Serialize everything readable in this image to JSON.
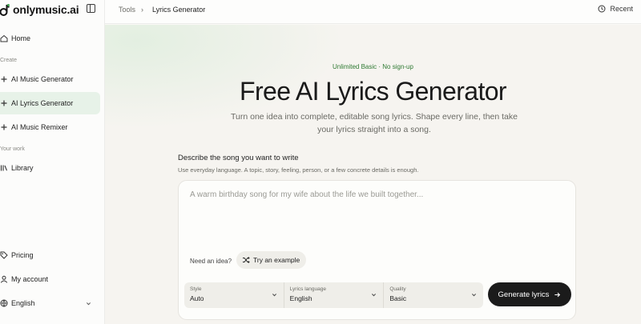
{
  "app": {
    "name": "onlymusic.ai"
  },
  "sidebar": {
    "sections": {
      "create": "Create",
      "your_work": "Your work"
    },
    "items": [
      {
        "label": "Home",
        "icon": "home-icon"
      },
      {
        "label": "AI Music Generator",
        "icon": "plus-icon"
      },
      {
        "label": "AI Lyrics Generator",
        "icon": "plus-icon",
        "active": true
      },
      {
        "label": "AI Music Remixer",
        "icon": "plus-icon"
      },
      {
        "label": "Library",
        "icon": "library-icon"
      },
      {
        "label": "Pricing",
        "icon": "tag-icon"
      },
      {
        "label": "My account",
        "icon": "user-icon"
      },
      {
        "label": "English",
        "icon": "globe-icon"
      }
    ]
  },
  "topbar": {
    "breadcrumb": {
      "parent": "Tools",
      "separator": "›",
      "current": "Lyrics Generator"
    },
    "recent_label": "Recent"
  },
  "hero": {
    "badge": "Unlimited Basic · No sign-up",
    "title": "Free AI Lyrics Generator",
    "subtitle": "Turn one idea into complete, editable song lyrics. Shape every line, then take your lyrics straight into a song."
  },
  "form": {
    "label": "Describe the song you want to write",
    "help": "Use everyday language. A topic, story, feeling, person, or a few concrete details is enough.",
    "placeholder": "A warm birthday song for my wife about the life we built together...",
    "need_idea": "Need an idea?",
    "try_example": "Try an example",
    "style": {
      "caption": "Style",
      "value": "Auto"
    },
    "language": {
      "caption": "Lyrics language",
      "value": "English"
    },
    "quality": {
      "caption": "Quality",
      "value": "Basic"
    },
    "generate": "Generate lyrics"
  },
  "colors": {
    "accent_green": "#2f7a33",
    "active_nav": "#e7f2e8",
    "primary_button": "#1b1b1b"
  }
}
